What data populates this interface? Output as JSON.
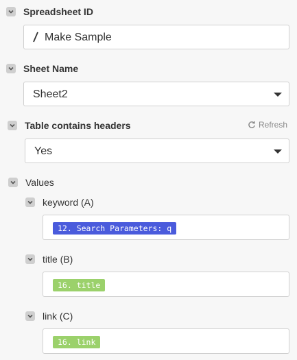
{
  "spreadsheet": {
    "label": "Spreadsheet ID",
    "value": "Make Sample",
    "value_icon": "slash-icon"
  },
  "sheet": {
    "label": "Sheet Name",
    "value": "Sheet2"
  },
  "headers": {
    "label": "Table contains headers",
    "refresh_label": "Refresh",
    "value": "Yes"
  },
  "values": {
    "label": "Values",
    "fields": [
      {
        "label": "keyword (A)",
        "pill": "12. Search Parameters: q",
        "pill_color": "#4a5bdc"
      },
      {
        "label": "title (B)",
        "pill": "16. title",
        "pill_color": "#9bd16b"
      },
      {
        "label": "link (C)",
        "pill": "16. link",
        "pill_color": "#9bd16b"
      }
    ]
  }
}
